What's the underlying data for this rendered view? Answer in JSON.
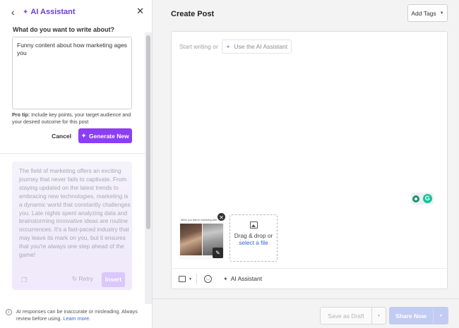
{
  "ai_panel": {
    "title": "AI Assistant",
    "back_icon": "chevron-left-icon",
    "close_icon": "close-icon",
    "question": "What do you want to write about?",
    "prompt_value": "Funny content about how marketing ages you",
    "protip_label": "Pro tip:",
    "protip_text": " Include key points, your target audience and your desired outcome for this post",
    "cancel_label": "Cancel",
    "generate_label": "Generate New",
    "result_text": "The field of marketing offers an exciting journey that never fails to captivate. From staying updated on the latest trends to embracing new technologies, marketing is a dynamic world that constantly challenges you. Late nights spent analyzing data and brainstorming innovative ideas are routine occurrences. It's a fast-paced industry that may leave its mark on you, but it ensures that you're always one step ahead of the game!",
    "retry_label": "Retry",
    "insert_label": "Insert",
    "disclaimer_text": "AI responses can be inaccurate or misleading. Always review before using.",
    "disclaimer_link": "Learn more."
  },
  "post": {
    "title": "Create Post",
    "add_tags_label": "Add Tags",
    "placeholder": "Start writing or",
    "use_ai_label": "Use the AI Assistant",
    "media_caption": "When you start in marketing   after working in marketing",
    "dropzone_text": "Drag & drop or",
    "dropzone_link": "select a file",
    "toolbar_ai_label": "AI Assistant",
    "grammarly_letter": "G"
  },
  "footer": {
    "save_draft_label": "Save as Draft",
    "share_now_label": "Share Now"
  },
  "colors": {
    "accent_purple": "#8b3ff0",
    "share_button": "#c2cbf2",
    "grammarly_green": "#15c39a"
  }
}
